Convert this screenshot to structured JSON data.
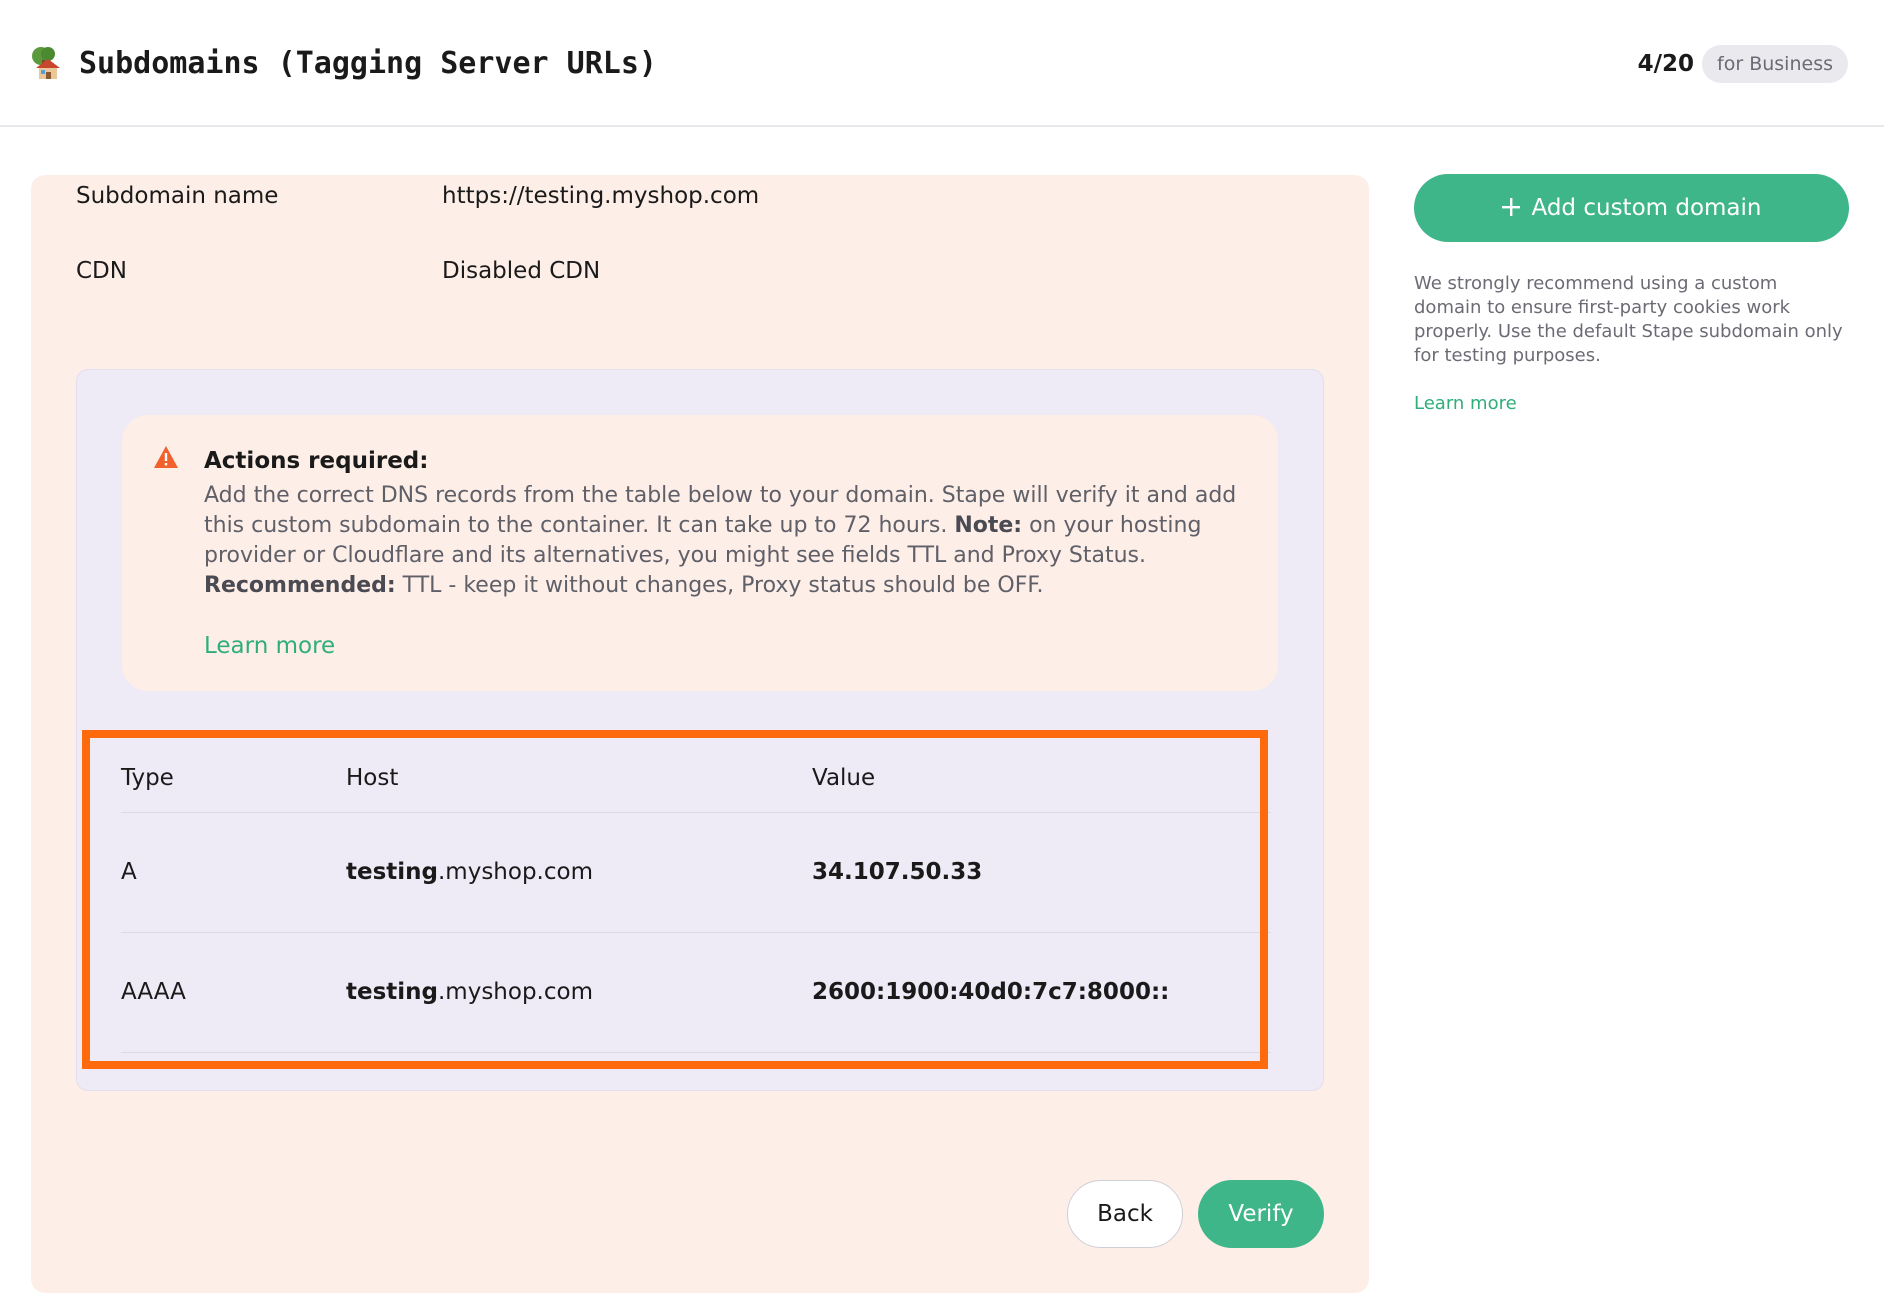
{
  "header": {
    "icon": "house-tree-icon",
    "title": "Subdomains (Tagging Server URLs)",
    "usage": "4/20",
    "plan_badge": "for Business"
  },
  "subdomain": {
    "name_label": "Subdomain name",
    "name_value": "https://testing.myshop.com",
    "cdn_label": "CDN",
    "cdn_value": "Disabled CDN"
  },
  "alert": {
    "icon": "warning-icon",
    "title": "Actions required:",
    "text_part1": "Add the correct DNS records from the table below to your domain. Stape will verify it and add this custom subdomain to the container. It can take up to 72 hours. ",
    "note_label": "Note:",
    "text_part2": " on your hosting provider or Cloudflare and its alternatives, you might see fields TTL and Proxy Status. ",
    "recommended_label": "Recommended:",
    "text_part3": " TTL - keep it without changes, Proxy status should be OFF.",
    "link": "Learn more"
  },
  "dns_table": {
    "headers": {
      "type": "Type",
      "host": "Host",
      "value": "Value"
    },
    "rows": [
      {
        "type": "A",
        "host_sub": "testing",
        "host_domain": ".myshop.com",
        "value": "34.107.50.33"
      },
      {
        "type": "AAAA",
        "host_sub": "testing",
        "host_domain": ".myshop.com",
        "value": "2600:1900:40d0:7c7:8000::"
      }
    ]
  },
  "actions": {
    "back": "Back",
    "verify": "Verify"
  },
  "sidebar": {
    "add_domain": "Add custom domain",
    "recommendation": "We strongly recommend using a custom domain to ensure first-party cookies work properly. Use the default Stape subdomain only for testing purposes.",
    "learn_more": "Learn more"
  },
  "colors": {
    "accent": "#3fb68a",
    "card_background": "#fdeee8",
    "panel_background": "#eeebf6",
    "highlight": "#ff6a0d",
    "warning": "#f2602e"
  }
}
